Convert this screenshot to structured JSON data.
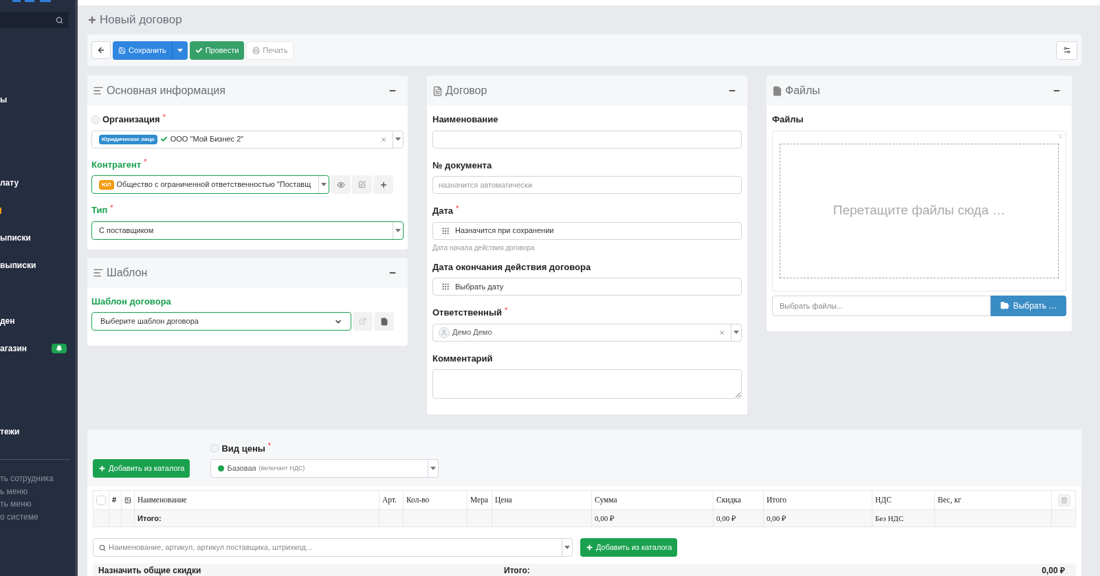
{
  "sidebar": {
    "groups": [
      [
        {
          "kind": "item",
          "label": "ы"
        }
      ],
      [
        {
          "kind": "item",
          "label": "лату"
        },
        {
          "kind": "mark"
        },
        {
          "kind": "item",
          "label": "ыписки"
        },
        {
          "kind": "item",
          "label": "выписки"
        }
      ],
      [
        {
          "kind": "item",
          "label": "ден"
        },
        {
          "kind": "item",
          "label": "агазин",
          "badge": true
        }
      ],
      [
        {
          "kind": "item",
          "label": "тежи"
        }
      ]
    ],
    "footer": [
      "ть сотрудника",
      "ь меню",
      "ть меню",
      "о системе"
    ]
  },
  "page_title": "Новый договор",
  "toolbar": {
    "save": "Сохранить",
    "post": "Провести",
    "print": "Печать"
  },
  "main_info": {
    "title": "Основная информация",
    "organization": {
      "label": "Организация",
      "required": "*",
      "valid": false,
      "tag": "Юридическое лицо",
      "value": "ООО \"Мой Бизнес 2\""
    },
    "counterparty": {
      "label": "Контрагент",
      "required": "*",
      "valid": true,
      "tag": "ЮЛ",
      "value": "Общество с ограниченной ответственностью \"Поставщ"
    },
    "type": {
      "label": "Тип",
      "required": "*",
      "valid": true,
      "value": "С поставщиком"
    }
  },
  "template": {
    "title": "Шаблон",
    "field": {
      "label": "Шаблон договора",
      "valid": true,
      "value": "Выберите шаблон договора"
    }
  },
  "contract": {
    "title": "Договор",
    "fields": [
      {
        "kind": "text",
        "label": "Наименование"
      },
      {
        "kind": "text",
        "label": "№ документа",
        "placeholder": "назначится автоматически"
      },
      {
        "kind": "date",
        "label": "Дата",
        "required": "*",
        "value": "Назначится при сохранении",
        "help": "Дата начала действия договора"
      },
      {
        "kind": "date",
        "label": "Дата окончания действия договора",
        "placeholder": "Выбрать дату"
      },
      {
        "kind": "user",
        "label": "Ответственный",
        "required": "*",
        "value": "Демо Демо"
      },
      {
        "kind": "textarea",
        "label": "Комментарий"
      }
    ]
  },
  "files": {
    "title": "Файлы",
    "label": "Файлы",
    "drop_hint": "Перетащите файлы сюда …",
    "input_placeholder": "Выбрать файлы...",
    "browse": "Выбрать …"
  },
  "items": {
    "add_button": "Добавить из каталога",
    "price_type": {
      "label": "Вид цены",
      "required": "*",
      "value": "Базовая",
      "note": "(включает НДС)",
      "color": "#1aa14f"
    },
    "table": {
      "select_all_checked": false,
      "columns": [
        "#",
        "Наименование",
        "Арт.",
        "Кол-во",
        "Мера",
        "Цена",
        "Сумма",
        "Скидка",
        "Итого",
        "НДС",
        "Вес, кг"
      ],
      "total_row": {
        "label": "Итого:",
        "sum": "0,00 ₽",
        "discount": "0,00 ₽",
        "total": "0,00 ₽",
        "vat": "Без НДС"
      }
    },
    "search": {
      "placeholder": "Наименование, артикул, артикул поставщика, штрихкод..."
    },
    "add_button_2": "Добавить из каталога",
    "summary": {
      "discounts": "Назначить общие скидки",
      "total_label": "Итого:",
      "total": "0,00 ₽"
    }
  }
}
